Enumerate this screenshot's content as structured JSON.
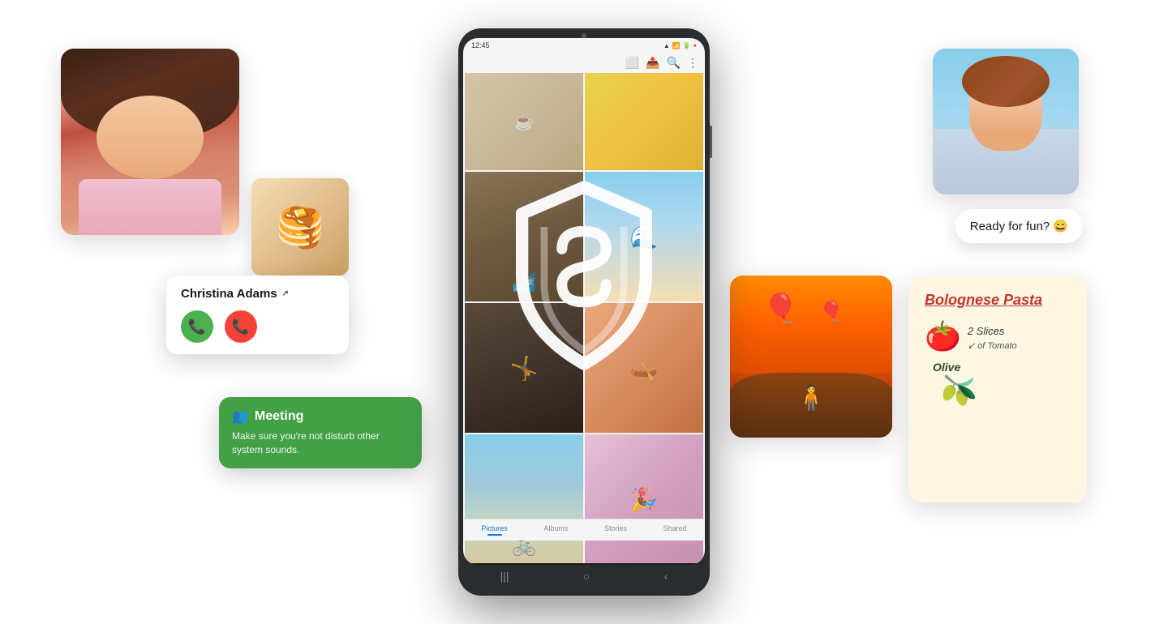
{
  "tablet": {
    "status_bar": {
      "time": "12:45",
      "wifi_icon": "wifi",
      "battery_icon": "battery",
      "notification_icon": "bell"
    },
    "gallery": {
      "toolbar_icons": [
        "copy-icon",
        "share-icon",
        "search-icon",
        "more-icon"
      ],
      "nav_items": [
        {
          "label": "Pictures",
          "active": true
        },
        {
          "label": "Albums",
          "active": false
        },
        {
          "label": "Stories",
          "active": false
        },
        {
          "label": "Shared",
          "active": false
        }
      ]
    }
  },
  "call_notification": {
    "name": "Christina Adams",
    "ext_link_icon": "external-link",
    "accept_label": "accept",
    "decline_label": "decline"
  },
  "meeting_notification": {
    "icon": "people-icon",
    "title": "Meeting",
    "body": "Make sure you're not disturb other system sounds."
  },
  "message_bubble": {
    "text": "Ready for fun? 😄"
  },
  "recipe_card": {
    "title": "Bolognese Pasta",
    "ingredient_1": "2 Slices\nof Tomato",
    "ingredient_2": "Olive",
    "tomato_emoji": "🍅",
    "olive_emoji": "🫒"
  },
  "shield": {
    "description": "Samsung Knox security shield overlay"
  },
  "profile": {
    "description": "Woman smiling selfie photo"
  },
  "beach_profile": {
    "description": "Woman at beach smiling photo"
  },
  "balloon": {
    "description": "Hot air balloons landscape photo"
  }
}
